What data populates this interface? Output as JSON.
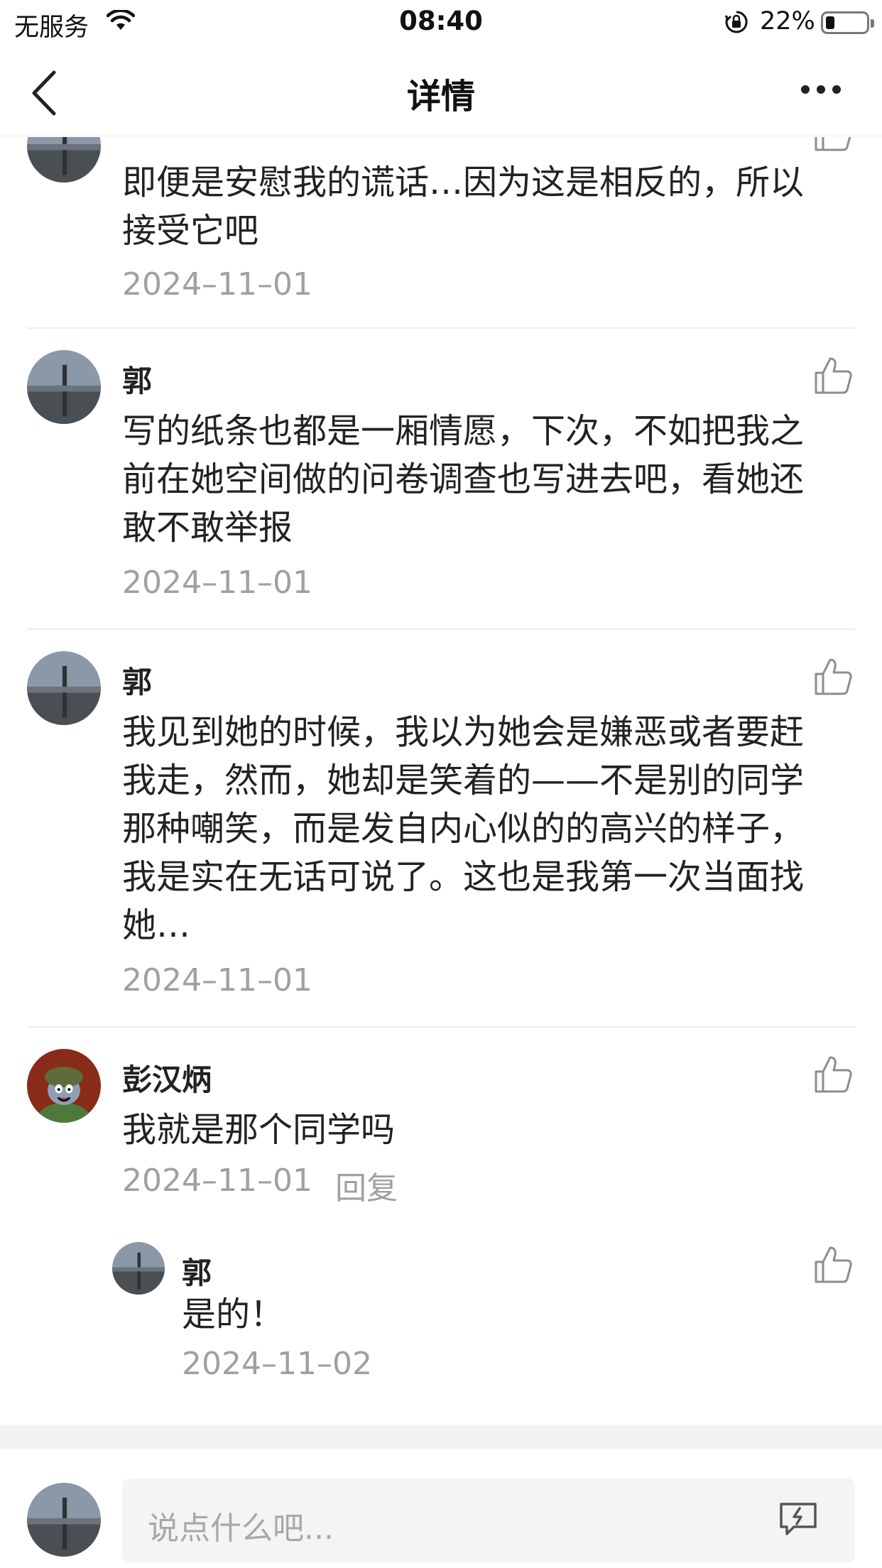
{
  "status_bar": {
    "carrier": "无服务",
    "time": "08:40",
    "battery_pct": "22%",
    "battery_level": 0.22
  },
  "nav": {
    "title": "详情"
  },
  "comments": [
    {
      "text": "即便是安慰我的谎话…因为这是相反的，所以接受它吧",
      "date": "2024–11–01"
    },
    {
      "name": "郭",
      "text": "写的纸条也都是一厢情愿，下次，不如把我之前在她空间做的问卷调查也写进去吧，看她还敢不敢举报",
      "date": "2024–11–01"
    },
    {
      "name": "郭",
      "text": "我见到她的时候，我以为她会是嫌恶或者要赶我走，然而，她却是笑着的——不是别的同学那种嘲笑，而是发自内心似的的高兴的样子，我是实在无话可说了。这也是我第一次当面找她…",
      "date": "2024–11–01"
    },
    {
      "name": "彭汉炳",
      "text": "我就是那个同学吗",
      "date": "2024–11–01",
      "reply_label": "回复"
    }
  ],
  "sub_reply": {
    "name": "郭",
    "text": "是的！",
    "date": "2024–11–02"
  },
  "input": {
    "placeholder": "说点什么吧..."
  },
  "colors": {
    "secondary_text": "#a0a0a0",
    "divider": "#ececec"
  },
  "icons": [
    "wifi-icon",
    "orientation-lock-icon",
    "battery-icon",
    "back-arrow-icon",
    "more-icon",
    "thumbs-up-icon",
    "emoji-icon"
  ]
}
